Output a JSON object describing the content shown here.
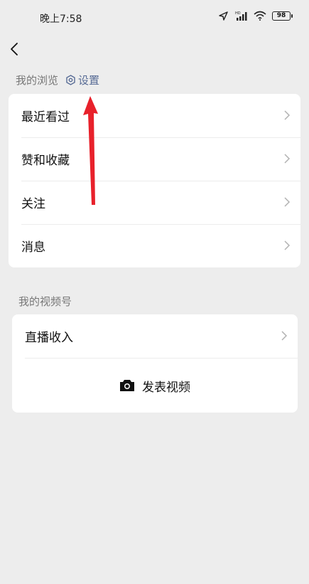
{
  "status_bar": {
    "time": "晚上7:58",
    "battery": "98"
  },
  "browse_section": {
    "title": "我的浏览",
    "settings_label": "设置",
    "items": [
      {
        "label": "最近看过"
      },
      {
        "label": "赞和收藏"
      },
      {
        "label": "关注"
      },
      {
        "label": "消息"
      }
    ]
  },
  "channels_section": {
    "title": "我的视频号",
    "items": [
      {
        "label": "直播收入"
      }
    ],
    "publish_label": "发表视频"
  },
  "colors": {
    "background": "#ededed",
    "link": "#576b95",
    "annotation_arrow": "#e8212b"
  }
}
